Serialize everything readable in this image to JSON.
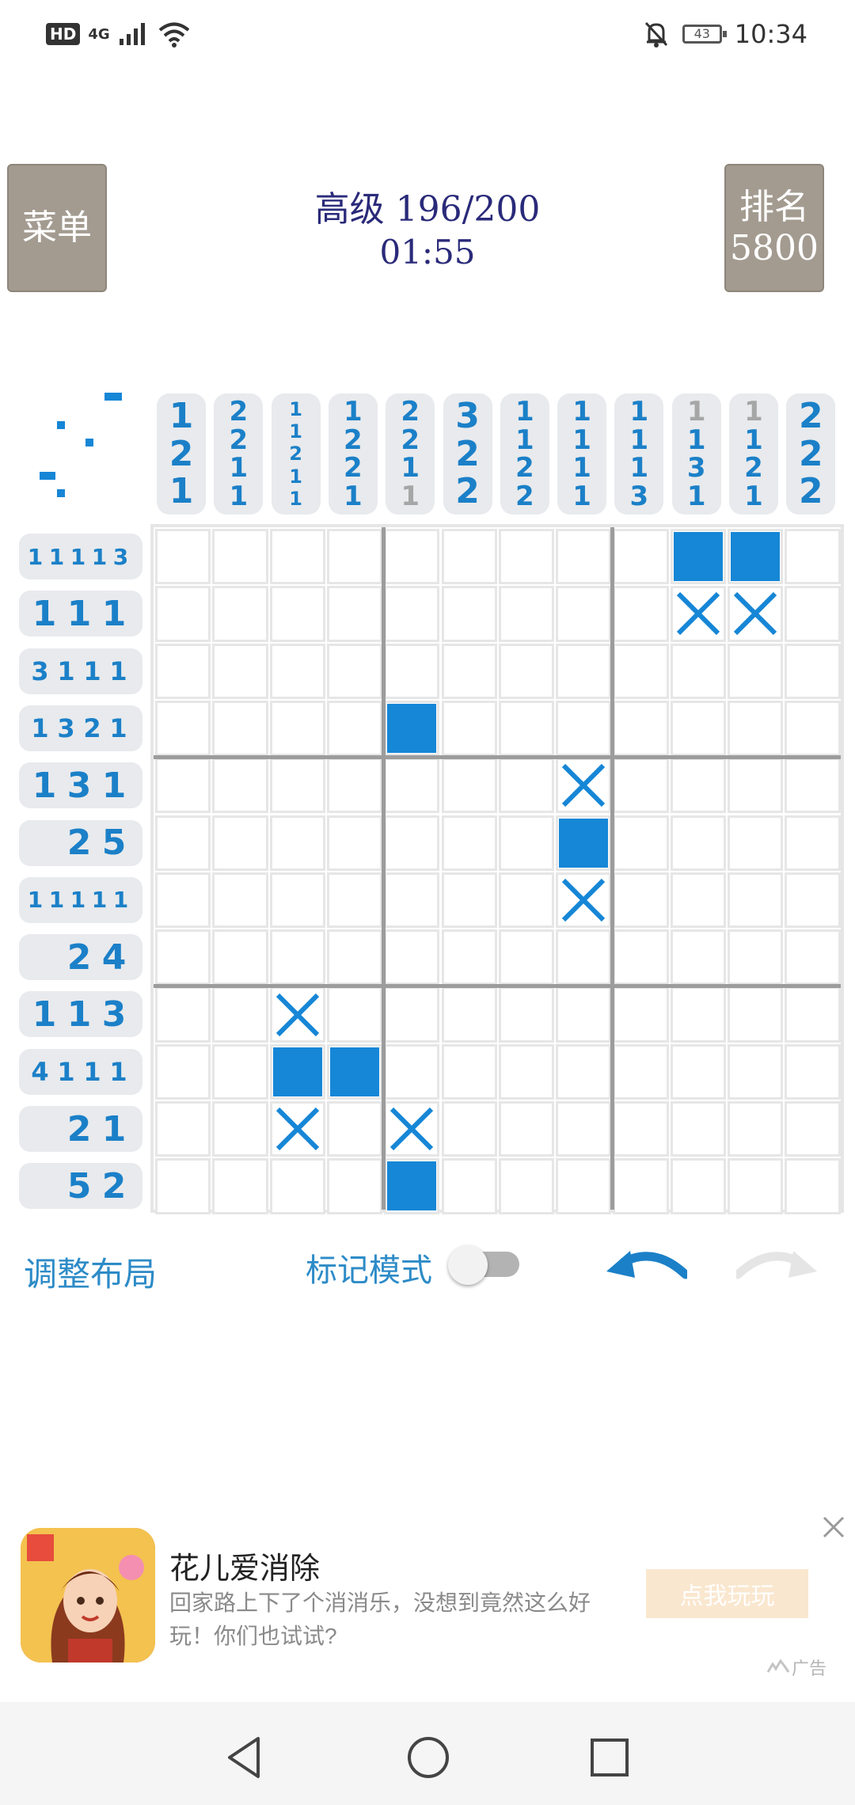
{
  "status_bar": {
    "hd": "HD",
    "network": "4G",
    "battery": "43",
    "time": "10:34"
  },
  "header": {
    "menu_label": "菜单",
    "level": "高级 196/200",
    "timer": "01:55",
    "rank_label": "排名",
    "rank_value": "5800"
  },
  "puzzle": {
    "column_clues": [
      [
        {
          "v": "1"
        },
        {
          "v": "2"
        },
        {
          "v": "1"
        }
      ],
      [
        {
          "v": "2"
        },
        {
          "v": "2"
        },
        {
          "v": "1"
        },
        {
          "v": "1"
        }
      ],
      [
        {
          "v": "1"
        },
        {
          "v": "1"
        },
        {
          "v": "2"
        },
        {
          "v": "1"
        },
        {
          "v": "1"
        }
      ],
      [
        {
          "v": "1"
        },
        {
          "v": "2"
        },
        {
          "v": "2"
        },
        {
          "v": "1"
        }
      ],
      [
        {
          "v": "2"
        },
        {
          "v": "2"
        },
        {
          "v": "1"
        },
        {
          "v": "1",
          "done": true
        }
      ],
      [
        {
          "v": "3"
        },
        {
          "v": "2"
        },
        {
          "v": "2"
        }
      ],
      [
        {
          "v": "1"
        },
        {
          "v": "1"
        },
        {
          "v": "2"
        },
        {
          "v": "2"
        }
      ],
      [
        {
          "v": "1"
        },
        {
          "v": "1"
        },
        {
          "v": "1"
        },
        {
          "v": "1"
        }
      ],
      [
        {
          "v": "1"
        },
        {
          "v": "1"
        },
        {
          "v": "1"
        },
        {
          "v": "3"
        }
      ],
      [
        {
          "v": "1",
          "done": true
        },
        {
          "v": "1"
        },
        {
          "v": "3"
        },
        {
          "v": "1"
        }
      ],
      [
        {
          "v": "1",
          "done": true
        },
        {
          "v": "1"
        },
        {
          "v": "2"
        },
        {
          "v": "1"
        }
      ],
      [
        {
          "v": "2"
        },
        {
          "v": "2"
        },
        {
          "v": "2"
        }
      ]
    ],
    "row_clues": [
      [
        "1",
        "1",
        "1",
        "1",
        "3"
      ],
      [
        "1",
        "1",
        "1"
      ],
      [
        "3",
        "1",
        "1",
        "1"
      ],
      [
        "1",
        "3",
        "2",
        "1"
      ],
      [
        "1",
        "3",
        "1"
      ],
      [
        "2",
        "5"
      ],
      [
        "1",
        "1",
        "1",
        "1",
        "1"
      ],
      [
        "2",
        "4"
      ],
      [
        "1",
        "1",
        "3"
      ],
      [
        "4",
        "1",
        "1",
        "1"
      ],
      [
        "2",
        "1"
      ],
      [
        "5",
        "2"
      ]
    ],
    "cells": [
      "000000000110",
      "000000000220",
      "000000000000",
      "000010000000",
      "000000020000",
      "000000010000",
      "000000020000",
      "000000000000",
      "002000000000",
      "001100000000",
      "002020000000",
      "000010000000"
    ]
  },
  "controls": {
    "adjust_layout": "调整布局",
    "mark_mode": "标记模式",
    "mark_mode_on": false
  },
  "ad": {
    "title": "花儿爱消除",
    "description": "回家路上下了个消消乐，没想到竟然这么好玩！你们也试试?",
    "button": "点我玩玩",
    "tag": "广告"
  },
  "colors": {
    "accent": "#1686d6",
    "clue_text": "#1b80c8",
    "side_button": "#a39b90"
  }
}
